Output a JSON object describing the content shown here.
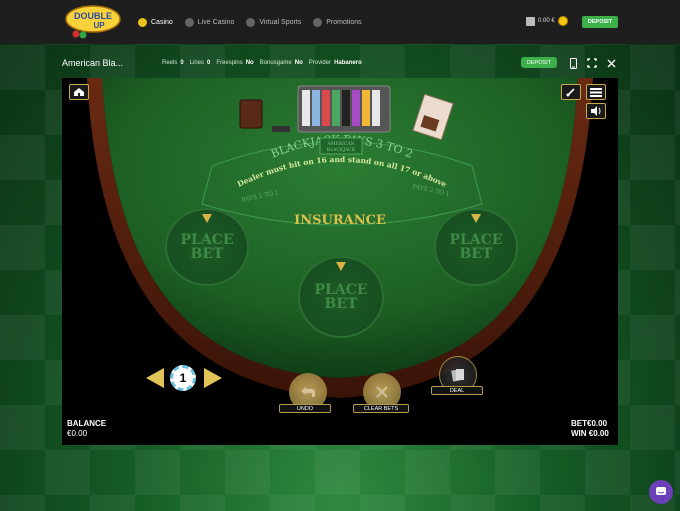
{
  "brand": {
    "logo_text_1": "DOUBLE",
    "logo_text_2": "UP"
  },
  "nav": {
    "items": [
      {
        "label": "Casino",
        "icon": "casino-icon"
      },
      {
        "label": "Live Casino",
        "icon": "live-casino-icon"
      },
      {
        "label": "Virtual Sports",
        "icon": "virtual-sports-icon"
      },
      {
        "label": "Promotions",
        "icon": "promotions-icon"
      }
    ],
    "balance": "0.00 €",
    "deposit_label": "DEPOSIT"
  },
  "game_header": {
    "title": "American Bla...",
    "reels_label": "Reels",
    "reels_value": "0",
    "lines_label": "Lines",
    "lines_value": "0",
    "freespins_label": "Freespins",
    "freespins_value": "No",
    "bonusgame_label": "Bonusgame",
    "bonusgame_value": "No",
    "provider_label": "Provider",
    "provider_value": "Habanero",
    "deposit_label": "DEPOSIT"
  },
  "table": {
    "logo_line1": "AMERICAN",
    "logo_line2": "BLACKJACK",
    "arc_title": "BLACKJACK PAYS 3 TO 2",
    "arc_rule": "Dealer must hit on 16 and stand on all 17 or above",
    "pays_left": "PAYS 2 TO 1",
    "pays_right": "PAYS 2 TO 1",
    "insurance": "INSURANCE",
    "spots": [
      {
        "line1": "PLACE",
        "line2": "BET"
      },
      {
        "line1": "PLACE",
        "line2": "BET"
      },
      {
        "line1": "PLACE",
        "line2": "BET"
      }
    ]
  },
  "controls": {
    "chip_value": "1",
    "undo_label": "UNDO",
    "clear_label": "CLEAR BETS",
    "deal_label": "DEAL"
  },
  "readouts": {
    "balance_label": "BALANCE",
    "balance_value": "€0.00",
    "bet_label": "BET",
    "bet_value": "€0.00",
    "win_label": "WIN",
    "win_value": "€0.00"
  },
  "colors": {
    "accent_green": "#3cb04a",
    "felt": "#1e6b28",
    "gold": "#d8b448"
  }
}
